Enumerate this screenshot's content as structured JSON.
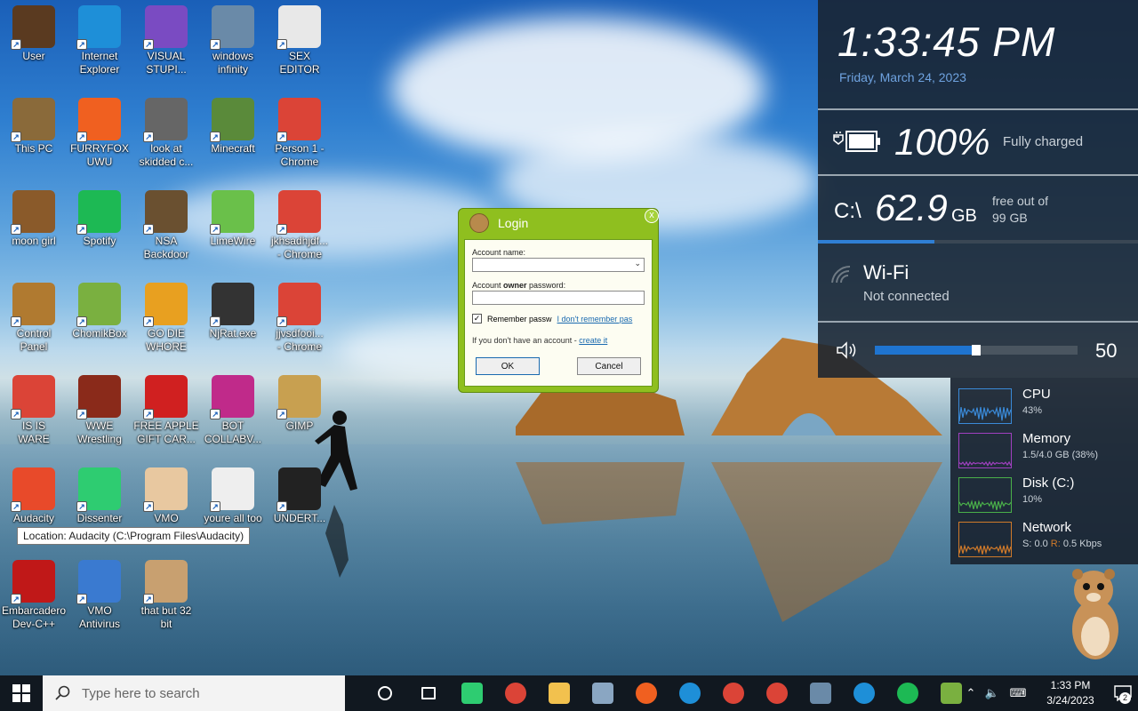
{
  "desktop_icons": [
    {
      "label": "User",
      "icon": "user-folder-icon",
      "color": "#5a3a20"
    },
    {
      "label": "Internet\nExplorer",
      "icon": "edge-icon",
      "color": "#1e8fd8"
    },
    {
      "label": "VISUAL\nSTUPI...",
      "icon": "visual-studio-icon",
      "color": "#7a4bc2"
    },
    {
      "label": "windows\ninfinity",
      "icon": "box-icon",
      "color": "#6a8aa8"
    },
    {
      "label": "SEX\nEDITOR",
      "icon": "hxd-icon",
      "color": "#e8e8e8"
    },
    {
      "label": "This PC",
      "icon": "computer-icon",
      "color": "#8a6a3a"
    },
    {
      "label": "FURRYFOX\nUWU",
      "icon": "firefox-icon",
      "color": "#f06020"
    },
    {
      "label": "look at\nskidded c...",
      "icon": "stack-icon",
      "color": "#666666"
    },
    {
      "label": "Minecraft",
      "icon": "minecraft-icon",
      "color": "#5a8a3a"
    },
    {
      "label": "Person 1 -\nChrome",
      "icon": "chrome-icon",
      "color": "#db4437"
    },
    {
      "label": "moon girl",
      "icon": "barrel-icon",
      "color": "#8a5a2a"
    },
    {
      "label": "Spotify",
      "icon": "spotify-icon",
      "color": "#1db954"
    },
    {
      "label": "NSA\nBackdoor",
      "icon": "safe-icon",
      "color": "#6a5030"
    },
    {
      "label": "LimeWire",
      "icon": "limewire-icon",
      "color": "#6ac04a"
    },
    {
      "label": "jkhsadhjdf...\n- Chrome",
      "icon": "chrome-icon",
      "color": "#db4437"
    },
    {
      "label": "Control\nPanel",
      "icon": "control-panel-icon",
      "color": "#b07a30"
    },
    {
      "label": "ChomikBox",
      "icon": "chomikbox-icon",
      "color": "#7ab040"
    },
    {
      "label": "GO DIE\nWHORE",
      "icon": "de-icon",
      "color": "#e8a020"
    },
    {
      "label": "NjRat.exe",
      "icon": "skull-icon",
      "color": "#333333"
    },
    {
      "label": "jjvsdfooi...\n- Chrome",
      "icon": "chrome-icon",
      "color": "#db4437"
    },
    {
      "label": "IS IS\nWARE",
      "icon": "chrome-icon",
      "color": "#db4437"
    },
    {
      "label": "WWE\nWrestling",
      "icon": "wwe-icon",
      "color": "#8a2a1a"
    },
    {
      "label": "FREE APPLE\nGIFT CAR...",
      "icon": "apple-icon",
      "color": "#d02020"
    },
    {
      "label": "BOT\nCOLLABV...",
      "icon": "bot-icon",
      "color": "#c02a8a"
    },
    {
      "label": "GIMP",
      "icon": "file-icon",
      "color": "#c8a050"
    },
    {
      "label": "Audacity",
      "icon": "audacity-icon",
      "color": "#e84a2a"
    },
    {
      "label": "Dissenter",
      "icon": "dissenter-icon",
      "color": "#2ecc71"
    },
    {
      "label": "VMO",
      "icon": "doctor-icon",
      "color": "#e8c8a0"
    },
    {
      "label": "youre all too",
      "icon": "portrait-icon",
      "color": "#eeeeee"
    },
    {
      "label": "UNDERT...",
      "icon": "unity-icon",
      "color": "#222222"
    },
    {
      "label": "Embarcadero\nDev-C++",
      "icon": "devcpp-icon",
      "color": "#c01818"
    },
    {
      "label": "VMO\nAntivirus",
      "icon": "shield-icon",
      "color": "#3a7ad0"
    },
    {
      "label": "that but 32\nbit",
      "icon": "portrait-icon",
      "color": "#c8a070"
    }
  ],
  "tooltip": "Location: Audacity (C:\\Program Files\\Audacity)",
  "login": {
    "title": "Login",
    "account_label": "Account name:",
    "password_label_pre": "Account ",
    "password_label_bold": "owner",
    "password_label_post": " password:",
    "account_value": "",
    "password_value": "",
    "remember_label": "Remember passw",
    "forgot_link": "I don't remember pas",
    "no_account_text": "If you don't have an account - ",
    "create_link": "create it",
    "ok": "OK",
    "cancel": "Cancel",
    "close": "x"
  },
  "panel": {
    "time": "1:33:45 PM",
    "date": "Friday, March 24, 2023",
    "battery_pct": "100%",
    "battery_status": "Fully charged",
    "drive": "C:\\",
    "drive_free": "62.9",
    "drive_unit": "GB",
    "drive_free_text": "free out of",
    "drive_total": "99 GB",
    "drive_used_fraction": 0.365,
    "wifi_name": "Wi-Fi",
    "wifi_status": "Not connected",
    "volume": "50",
    "volume_fraction": 0.5
  },
  "perf": [
    {
      "name": "CPU",
      "value": "43%",
      "color": "#3a8ad8"
    },
    {
      "name": "Memory",
      "value": "1.5/4.0 GB (38%)",
      "color": "#a040c0"
    },
    {
      "name": "Disk (C:)",
      "value": "10%",
      "color": "#4ab04a"
    },
    {
      "name": "Network",
      "value_s": "S: 0.0 ",
      "value_r_label": "R:",
      "value_r": " 0.5 Kbps",
      "color": "#d07a2a"
    }
  ],
  "taskbar": {
    "search_placeholder": "Type here to search",
    "time": "1:33 PM",
    "date": "3/24/2023",
    "notification_count": "2",
    "apps": [
      {
        "name": "cortana-icon",
        "color": "#111820"
      },
      {
        "name": "task-view-icon",
        "color": "#111820"
      },
      {
        "name": "dissenter-icon",
        "color": "#2ecc71"
      },
      {
        "name": "chrome-icon",
        "color": "#db4437"
      },
      {
        "name": "file-explorer-icon",
        "color": "#f2c14e"
      },
      {
        "name": "box-icon",
        "color": "#8aa6c2"
      },
      {
        "name": "firefox-icon",
        "color": "#f06020"
      },
      {
        "name": "edge-icon",
        "color": "#1e8fd8"
      },
      {
        "name": "chrome-profile-icon",
        "color": "#db4437"
      },
      {
        "name": "chrome-profile2-icon",
        "color": "#db4437"
      },
      {
        "name": "gimp-icon",
        "color": "#6a8aa8"
      },
      {
        "name": "edge-icon",
        "color": "#1e8fd8"
      },
      {
        "name": "spotify-icon",
        "color": "#1db954"
      },
      {
        "name": "chomikbox-icon",
        "color": "#7ab040"
      }
    ]
  }
}
